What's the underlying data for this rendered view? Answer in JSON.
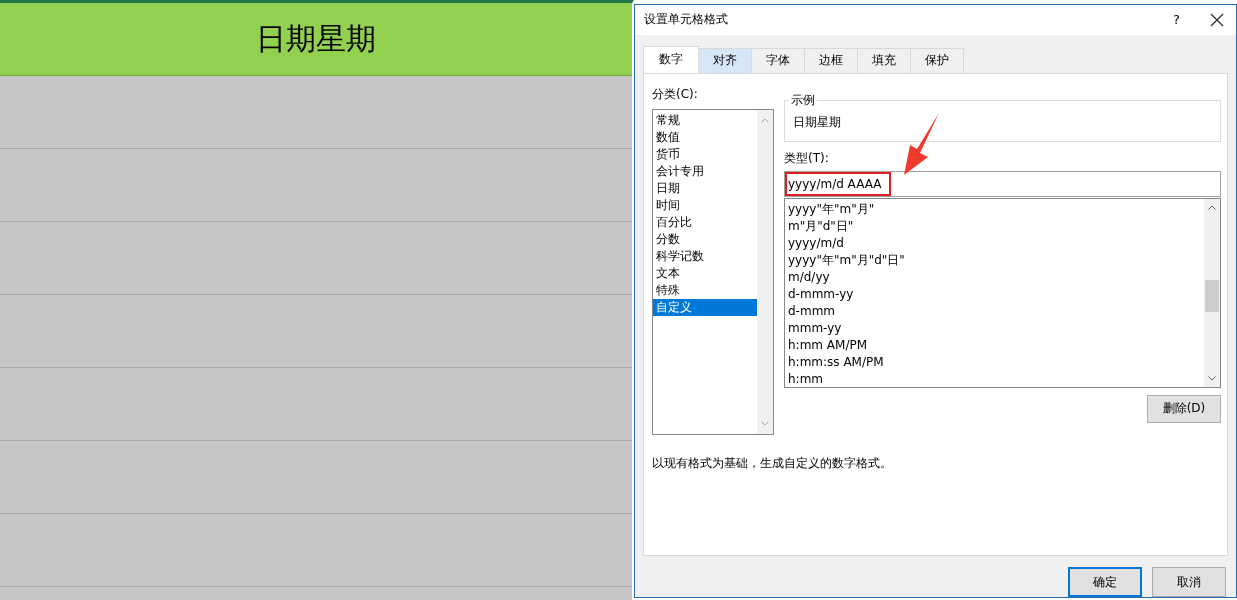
{
  "sheet": {
    "header_cell": "日期星期"
  },
  "dialog": {
    "title": "设置单元格格式",
    "help": "?",
    "tabs": [
      {
        "label": "数字",
        "selected": true
      },
      {
        "label": "对齐",
        "selected": false
      },
      {
        "label": "字体",
        "selected": false
      },
      {
        "label": "边框",
        "selected": false
      },
      {
        "label": "填充",
        "selected": false
      },
      {
        "label": "保护",
        "selected": false
      }
    ],
    "category_label": "分类(C):",
    "categories": [
      {
        "label": "常规",
        "selected": false
      },
      {
        "label": "数值",
        "selected": false
      },
      {
        "label": "货币",
        "selected": false
      },
      {
        "label": "会计专用",
        "selected": false
      },
      {
        "label": "日期",
        "selected": false
      },
      {
        "label": "时间",
        "selected": false
      },
      {
        "label": "百分比",
        "selected": false
      },
      {
        "label": "分数",
        "selected": false
      },
      {
        "label": "科学记数",
        "selected": false
      },
      {
        "label": "文本",
        "selected": false
      },
      {
        "label": "特殊",
        "selected": false
      },
      {
        "label": "自定义",
        "selected": true
      }
    ],
    "sample_label": "示例",
    "sample_value": "日期星期",
    "type_label": "类型(T):",
    "type_value": "yyyy/m/d AAAA",
    "type_list": [
      "yyyy\"年\"m\"月\"",
      "m\"月\"d\"日\"",
      "yyyy/m/d",
      "yyyy\"年\"m\"月\"d\"日\"",
      "m/d/yy",
      "d-mmm-yy",
      "d-mmm",
      "mmm-yy",
      "h:mm AM/PM",
      "h:mm:ss AM/PM",
      "h:mm"
    ],
    "delete_button": "删除(D)",
    "description": "以现有格式为基础，生成自定义的数字格式。",
    "buttons": [
      "确定",
      "取消"
    ]
  }
}
